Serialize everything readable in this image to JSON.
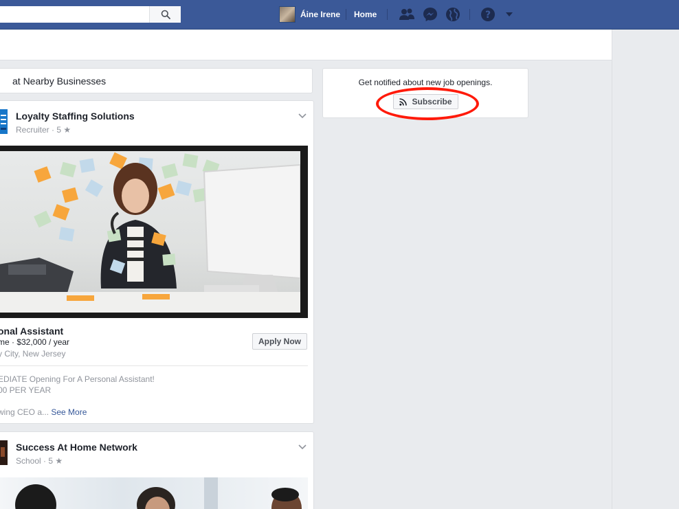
{
  "topbar": {
    "search": {
      "value": "",
      "placeholder": ""
    },
    "search_icon": "search-icon",
    "profile_name": "Áine Irene",
    "home_label": "Home",
    "icons": [
      "friends-icon",
      "messenger-icon",
      "notifications-globe-icon",
      "help-icon",
      "account-menu-caret-icon"
    ],
    "brand_color": "#3b5998"
  },
  "main": {
    "heading": "at Nearby Businesses",
    "jobs": [
      {
        "page_name": "Loyalty Staffing Solutions",
        "page_sub": "Recruiter · 5 ★",
        "title": "onal Assistant",
        "meta": "me · $32,000 / year",
        "location": "y City, New Jersey",
        "apply_label": "Apply Now",
        "desc_line1": "EDIATE Opening For A Personal Assistant!",
        "desc_line2": "00 PER YEAR",
        "desc_line3": "wing CEO a...",
        "see_more": "See More"
      },
      {
        "page_name": "Success At Home Network",
        "page_sub": "School · 5 ★"
      }
    ]
  },
  "sidebar": {
    "notify_text": "Get notified about new job openings.",
    "subscribe_label": "Subscribe",
    "highlight_color": "#ff1a0a"
  }
}
